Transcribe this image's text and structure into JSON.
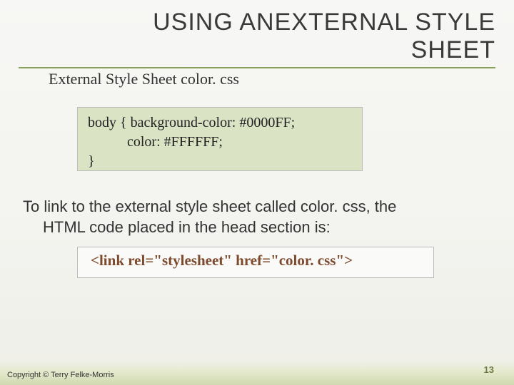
{
  "title": "USING ANEXTERNAL STYLE SHEET",
  "subtitle": "External Style Sheet color. css",
  "code1": "body { background-color: #0000FF;\n           color: #FFFFFF;\n}",
  "body_text_line1": "To link to the external style sheet called color. css, the",
  "body_text_line2": "HTML code placed in the head section is:",
  "code2": "<link rel=\"stylesheet\" href=\"color. css\">",
  "copyright": "Copyright © Terry Felke-Morris",
  "page_number": "13"
}
